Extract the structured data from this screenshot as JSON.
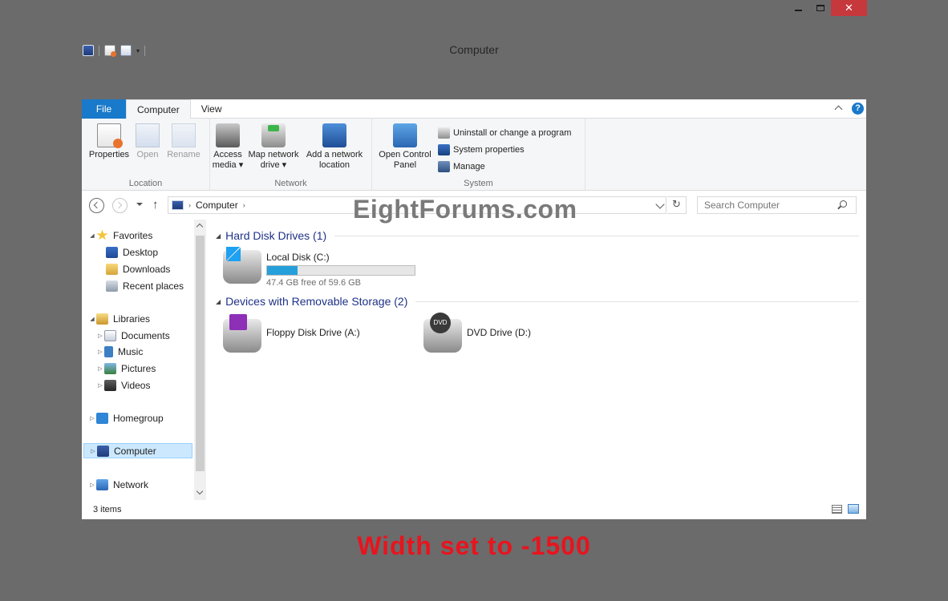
{
  "window": {
    "title": "Computer",
    "minimize_icon": "minimize-icon",
    "maximize_icon": "maximize-icon",
    "close_glyph": "✕"
  },
  "quick_access": {
    "icons": [
      "computer-icon",
      "properties-icon",
      "new-folder-icon",
      "customize-dropdown-icon"
    ]
  },
  "ribbon": {
    "tabs": [
      {
        "label": "File"
      },
      {
        "label": "Computer"
      },
      {
        "label": "View"
      }
    ],
    "help_glyph": "?",
    "groups": {
      "location": {
        "label": "Location",
        "buttons": [
          {
            "label": "Properties",
            "icon": "properties-icon"
          },
          {
            "label": "Open",
            "icon": "open-icon"
          },
          {
            "label": "Rename",
            "icon": "rename-icon"
          }
        ]
      },
      "network": {
        "label": "Network",
        "buttons": [
          {
            "line1": "Access",
            "line2": "media ▾",
            "icon": "access-media-icon"
          },
          {
            "line1": "Map network",
            "line2": "drive ▾",
            "icon": "map-network-drive-icon"
          },
          {
            "line1": "Add a network",
            "line2": "location",
            "icon": "add-network-location-icon"
          }
        ]
      },
      "system": {
        "label": "System",
        "big": {
          "line1": "Open Control",
          "line2": "Panel",
          "icon": "control-panel-icon"
        },
        "small": [
          {
            "label": "Uninstall or change a program",
            "icon": "uninstall-icon"
          },
          {
            "label": "System properties",
            "icon": "system-properties-icon"
          },
          {
            "label": "Manage",
            "icon": "manage-icon"
          }
        ]
      }
    }
  },
  "address_bar": {
    "path": "Computer",
    "chevron": "›",
    "up_glyph": "↑",
    "refresh_glyph": "↻",
    "search_placeholder": "Search Computer"
  },
  "watermark": "EightForums.com",
  "nav_pane": {
    "items": [
      {
        "label": "Favorites",
        "icon": "favorites-star-icon"
      },
      {
        "label": "Desktop",
        "icon": "desktop-icon"
      },
      {
        "label": "Downloads",
        "icon": "downloads-icon"
      },
      {
        "label": "Recent places",
        "icon": "recent-places-icon"
      },
      {
        "label": "Libraries",
        "icon": "libraries-icon"
      },
      {
        "label": "Documents",
        "icon": "documents-icon"
      },
      {
        "label": "Music",
        "icon": "music-icon"
      },
      {
        "label": "Pictures",
        "icon": "pictures-icon"
      },
      {
        "label": "Videos",
        "icon": "videos-icon"
      },
      {
        "label": "Homegroup",
        "icon": "homegroup-icon"
      },
      {
        "label": "Computer",
        "icon": "computer-icon",
        "selected": true
      },
      {
        "label": "Network",
        "icon": "network-icon"
      }
    ]
  },
  "content": {
    "groups": [
      {
        "header": "Hard Disk Drives (1)",
        "items": [
          {
            "name": "Local Disk (C:)",
            "free_text": "47.4 GB free of 59.6 GB",
            "used_fraction": 0.205,
            "icon": "hard-disk-icon"
          }
        ]
      },
      {
        "header": "Devices with Removable Storage (2)",
        "items": [
          {
            "name": "Floppy Disk Drive (A:)",
            "icon": "floppy-drive-icon"
          },
          {
            "name": "DVD Drive (D:)",
            "icon": "dvd-drive-icon"
          }
        ]
      }
    ]
  },
  "status_bar": {
    "item_count": "3 items",
    "view_icons": [
      "details-view-icon",
      "large-icons-view-icon"
    ]
  },
  "caption_note": "Width set to -1500",
  "colors": {
    "file_tab": "#1979ca",
    "close_button": "#c7383d",
    "drive_bar": "#26a0da",
    "note": "#e8141e",
    "group_header": "#1e3287"
  }
}
